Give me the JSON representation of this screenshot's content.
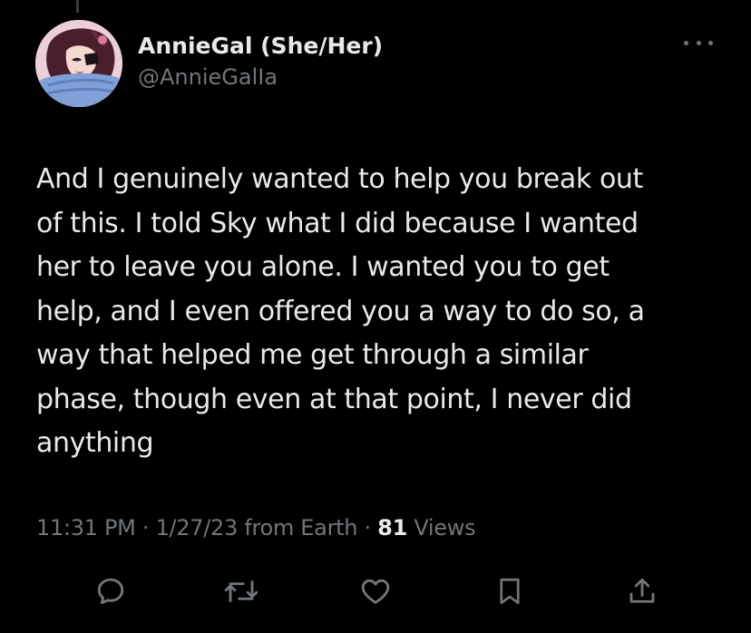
{
  "author": {
    "display_name": "AnnieGal (She/Her)",
    "handle": "@AnnieGalIa"
  },
  "tweet": {
    "lines": [
      "And I genuinely wanted to help you break out",
      "of this. I told Sky what I did because I wanted",
      "her to leave you alone. I wanted you to get",
      "help, and I even offered you a way to do so, a",
      "way that helped me get through a similar",
      "phase, though even at that point, I never did",
      "anything"
    ]
  },
  "meta": {
    "time": "11:31 PM",
    "separator": " · ",
    "date": "1/27/23",
    "source": " from Earth",
    "views_count": "81",
    "views_label": " Views"
  },
  "actions": {
    "reply_icon": "reply-icon",
    "retweet_icon": "retweet-icon",
    "like_icon": "heart-icon",
    "bookmark_icon": "bookmark-icon",
    "share_icon": "share-icon"
  },
  "colors": {
    "background": "#000000",
    "primary_text": "#e7e9ea",
    "secondary_text": "#71767b"
  }
}
